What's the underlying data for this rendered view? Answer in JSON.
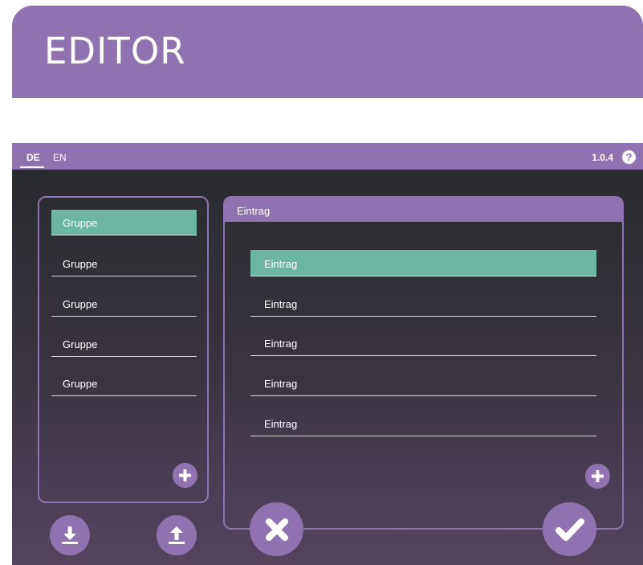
{
  "header": {
    "title": "EDITOR"
  },
  "language": {
    "items": [
      "DE",
      "EN"
    ],
    "active": "DE"
  },
  "version": "1.0.4",
  "groups": {
    "items": [
      {
        "label": "Gruppe",
        "active": true
      },
      {
        "label": "Gruppe",
        "active": false
      },
      {
        "label": "Gruppe",
        "active": false
      },
      {
        "label": "Gruppe",
        "active": false
      },
      {
        "label": "Gruppe",
        "active": false
      }
    ]
  },
  "entries": {
    "header": "Eintrag",
    "items": [
      {
        "label": "Eintrag",
        "active": true
      },
      {
        "label": "Eintrag",
        "active": false
      },
      {
        "label": "Eintrag",
        "active": false
      },
      {
        "label": "Eintrag",
        "active": false
      },
      {
        "label": "Eintrag",
        "active": false
      }
    ]
  },
  "icons": {
    "add": "plus-icon",
    "import": "download-icon",
    "export": "upload-icon",
    "cancel": "close-icon",
    "confirm": "check-icon",
    "help": "help-icon"
  },
  "colors": {
    "accent": "#8f73b1",
    "selected": "#6bb5a1",
    "background_top": "#242629",
    "background_bottom": "#54445f"
  }
}
